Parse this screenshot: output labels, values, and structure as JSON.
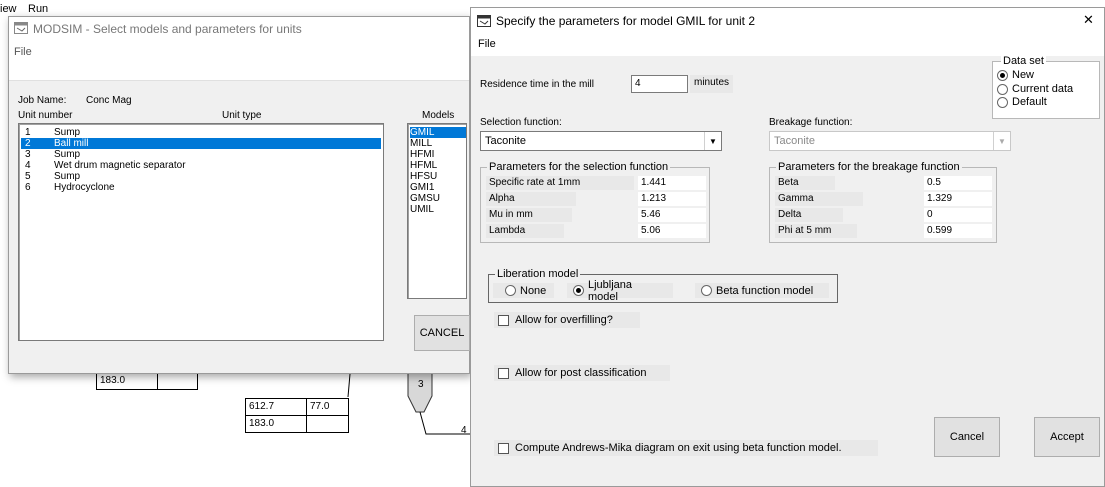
{
  "background": {
    "menu": [
      "iew",
      "Run"
    ],
    "cells": [
      "183.0",
      "612.7",
      "77.0",
      "183.0"
    ],
    "unit_labels": [
      "3",
      "4"
    ]
  },
  "modsim": {
    "title": "MODSIM - Select models and parameters for units",
    "menu": [
      "File"
    ],
    "job_name_label": "Job Name:",
    "job_name": "Conc Mag",
    "col_unit_number": "Unit number",
    "col_unit_type": "Unit type",
    "col_models": "Models",
    "units": [
      {
        "num": "1",
        "type": "Sump"
      },
      {
        "num": "2",
        "type": "Ball mill"
      },
      {
        "num": "3",
        "type": "Sump"
      },
      {
        "num": "4",
        "type": "Wet drum magnetic separator"
      },
      {
        "num": "5",
        "type": "Sump"
      },
      {
        "num": "6",
        "type": "Hydrocyclone"
      }
    ],
    "models": [
      "GMIL",
      "MILL",
      "HFMI",
      "HFML",
      "HFSU",
      "GMI1",
      "GMSU",
      "UMIL"
    ],
    "cancel": "CANCEL"
  },
  "dialog": {
    "title": "Specify the parameters for model GMIL for unit 2",
    "close": "✕",
    "menu": [
      "File"
    ],
    "residence_label": "Residence time in the mill",
    "residence_value": "4",
    "residence_unit": "minutes",
    "dataset": {
      "caption": "Data set",
      "options": [
        "New",
        "Current data",
        "Default"
      ],
      "selected": "New"
    },
    "selection_function_label": "Selection function:",
    "selection_function_value": "Taconite",
    "breakage_function_label": "Breakage function:",
    "breakage_function_value": "Taconite",
    "selection_params": {
      "caption": "Parameters for the selection function",
      "rows": [
        {
          "label": "Specific rate at 1mm",
          "value": "1.441"
        },
        {
          "label": "Alpha",
          "value": "1.213"
        },
        {
          "label": "Mu in mm",
          "value": "5.46"
        },
        {
          "label": "Lambda",
          "value": "5.06"
        }
      ]
    },
    "breakage_params": {
      "caption": "Parameters for the breakage function",
      "rows": [
        {
          "label": "Beta",
          "value": "0.5"
        },
        {
          "label": "Gamma",
          "value": "1.329"
        },
        {
          "label": "Delta",
          "value": "0"
        },
        {
          "label": "Phi at 5 mm",
          "value": "0.599"
        }
      ]
    },
    "liberation": {
      "caption": "Liberation model",
      "options": [
        "None",
        "Ljubljana model",
        "Beta function model"
      ],
      "selected": "Ljubljana model"
    },
    "overfilling": "Allow for overfilling?",
    "post_classification": "Allow for post classification",
    "andrews_mika": "Compute Andrews-Mika diagram on exit using beta function model.",
    "cancel": "Cancel",
    "accept": "Accept"
  }
}
